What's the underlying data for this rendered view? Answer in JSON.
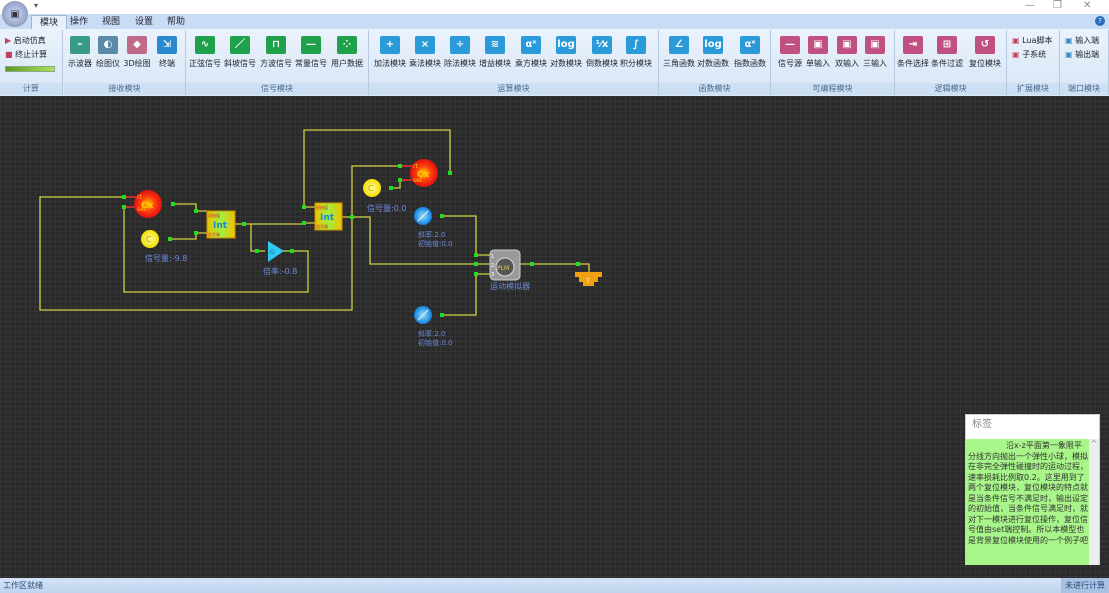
{
  "titlebar": {
    "quick_access": "▾",
    "minimize": "—",
    "restore": "❐",
    "close": "✕"
  },
  "tabs": [
    "模块",
    "操作",
    "视图",
    "设置",
    "帮助"
  ],
  "ribbon": {
    "compute": {
      "label": "计算",
      "start": "启动仿真",
      "stop": "终止计算",
      "progress": 1.0
    },
    "groups": [
      {
        "label": "接收模块",
        "items": [
          {
            "label": "示波器",
            "color": "#3a9a8a",
            "glyph": "⌁"
          },
          {
            "label": "绘图仪",
            "color": "#5a8aa8",
            "glyph": "◐"
          },
          {
            "label": "3D绘图",
            "color": "#c06a8a",
            "glyph": "◆"
          },
          {
            "label": "终端",
            "color": "#2a8ad0",
            "glyph": "⇲"
          }
        ]
      },
      {
        "label": "信号模块",
        "items": [
          {
            "label": "正弦信号",
            "color": "#1fa04a",
            "glyph": "∿"
          },
          {
            "label": "斜坡信号",
            "color": "#1fa04a",
            "glyph": "／"
          },
          {
            "label": "方波信号",
            "color": "#1fa04a",
            "glyph": "⊓"
          },
          {
            "label": "常量信号",
            "color": "#1fa04a",
            "glyph": "—"
          },
          {
            "label": "用户数据",
            "color": "#1fa04a",
            "glyph": "⁘"
          }
        ]
      },
      {
        "label": "运算模块",
        "items": [
          {
            "label": "加法模块",
            "color": "#2a9ad8",
            "glyph": "+"
          },
          {
            "label": "乘法模块",
            "color": "#2a9ad8",
            "glyph": "×"
          },
          {
            "label": "除法模块",
            "color": "#2a9ad8",
            "glyph": "÷"
          },
          {
            "label": "增益模块",
            "color": "#2a9ad8",
            "glyph": "≋"
          },
          {
            "label": "乘方模块",
            "color": "#2a9ad8",
            "glyph": "αˣ"
          },
          {
            "label": "对数模块",
            "color": "#2a9ad8",
            "glyph": "log"
          },
          {
            "label": "倒数模块",
            "color": "#2a9ad8",
            "glyph": "⅟x"
          },
          {
            "label": "积分模块",
            "color": "#2a9ad8",
            "glyph": "∫"
          }
        ]
      },
      {
        "label": "函数模块",
        "items": [
          {
            "label": "三角函数",
            "color": "#2a9ad8",
            "glyph": "∠"
          },
          {
            "label": "对数函数",
            "color": "#2a9ad8",
            "glyph": "log"
          },
          {
            "label": "指数函数",
            "color": "#2a9ad8",
            "glyph": "αˣ"
          }
        ]
      },
      {
        "label": "可编程模块",
        "items": [
          {
            "label": "信号源",
            "color": "#c05080",
            "glyph": "—"
          },
          {
            "label": "单输入",
            "color": "#c05080",
            "glyph": "▣"
          },
          {
            "label": "双输入",
            "color": "#c05080",
            "glyph": "▣"
          },
          {
            "label": "三输入",
            "color": "#c05080",
            "glyph": "▣"
          }
        ]
      },
      {
        "label": "逻辑模块",
        "items": [
          {
            "label": "条件选择",
            "color": "#c05080",
            "glyph": "⇥"
          },
          {
            "label": "条件过滤",
            "color": "#c05080",
            "glyph": "⊞"
          },
          {
            "label": "复位模块",
            "color": "#c05080",
            "glyph": "↺"
          }
        ]
      },
      {
        "label": "扩展模块",
        "items": [
          {
            "label": "Lua脚本"
          },
          {
            "label": "子系统"
          }
        ]
      },
      {
        "label": "端口模块",
        "items": [
          {
            "label": "输入端"
          },
          {
            "label": "输出端"
          }
        ]
      }
    ]
  },
  "diagram": {
    "counter_ports": [
      "rt",
      "set"
    ],
    "counter_glyph": "Cx",
    "const_glyph": "C",
    "int_glyph": "Int",
    "int_ports": [
      "初始值",
      "信号端"
    ],
    "gain_glyph": "G",
    "const1": "信号量:-9.8",
    "gain": "倍率:-0.8",
    "const2": "信号量:0.0",
    "ramp1": [
      "斜率:2.0",
      "初始值:0.0"
    ],
    "ramp2": [
      "斜率:2.0",
      "初始值:0.0"
    ],
    "simulator": "运动模拟器",
    "sim_ports": [
      "1",
      "2",
      "3"
    ],
    "sim_glyph": "PLM",
    "terminal_glyph": "T",
    "wire_color": "#d0d040",
    "port_color": "#22dd22"
  },
  "note": {
    "title": "标签",
    "text": "沿x-z平面第一象限平分线方向抛出一个弹性小球，模拟在非完全弹性碰撞时的运动过程，速率损耗比例取0.2。这里用到了两个复位模块，复位模块的特点就是当条件信号不满足时，输出设定的初始值，当条件信号满足时，就对下一模块进行复位操作，复位信号值由set端控制。所以本模型也是背景复位模块使用的一个例子吧"
  },
  "status": {
    "left": "工作区就绪",
    "right": "未进行计算"
  }
}
